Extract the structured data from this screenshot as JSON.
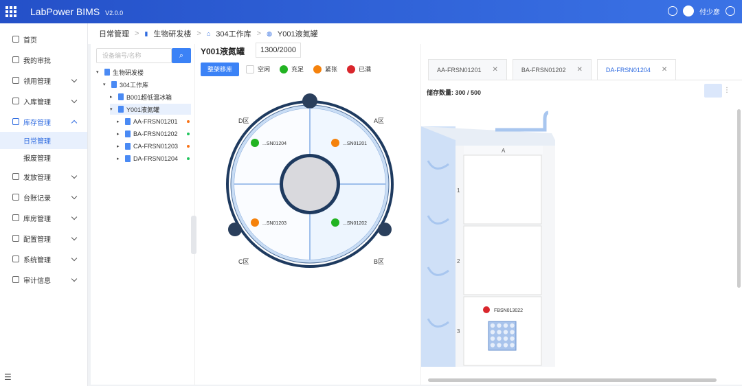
{
  "header": {
    "logo": "LabPower BIMS",
    "version": "V2.0.0",
    "user": "付少彦"
  },
  "sidebar": {
    "items": [
      {
        "label": "首页",
        "icon": "home-icon"
      },
      {
        "label": "我的审批",
        "icon": "approval-icon"
      },
      {
        "label": "领用管理",
        "icon": "claim-icon",
        "expandable": true
      },
      {
        "label": "入库管理",
        "icon": "inbound-icon",
        "expandable": true
      },
      {
        "label": "库存管理",
        "icon": "inventory-icon",
        "expandable": true,
        "active": true,
        "children": [
          {
            "label": "日常管理",
            "active": true
          },
          {
            "label": "报废管理"
          }
        ]
      },
      {
        "label": "发放管理",
        "icon": "dispatch-icon",
        "expandable": true
      },
      {
        "label": "台账记录",
        "icon": "ledger-icon",
        "expandable": true
      },
      {
        "label": "库房管理",
        "icon": "warehouse-icon",
        "expandable": true
      },
      {
        "label": "配置管理",
        "icon": "config-icon",
        "expandable": true
      },
      {
        "label": "系统管理",
        "icon": "system-icon",
        "expandable": true
      },
      {
        "label": "审计信息",
        "icon": "audit-icon",
        "expandable": true
      }
    ]
  },
  "breadcrumb": [
    "日常管理",
    "生物研发楼",
    "304工作库",
    "Y001液氮罐"
  ],
  "tree": {
    "search_placeholder": "设备编号/名称",
    "nodes": [
      {
        "label": "生物研发楼",
        "level": 0
      },
      {
        "label": "304工作库",
        "level": 1
      },
      {
        "label": "B001超低温冰箱",
        "level": 2
      },
      {
        "label": "Y001液氮罐",
        "level": 2,
        "selected": true
      },
      {
        "label": "AA-FRSN01201",
        "level": 3,
        "status": "#f97316"
      },
      {
        "label": "BA-FRSN01202",
        "level": 3,
        "status": "#22c55e"
      },
      {
        "label": "CA-FRSN01203",
        "level": 3,
        "status": "#f97316"
      },
      {
        "label": "DA-FRSN01204",
        "level": 3,
        "status": "#22c55e"
      }
    ]
  },
  "panel": {
    "title": "Y001液氮罐",
    "count": "1300/2000",
    "button": "整架移库",
    "legend": [
      {
        "label": "空闲",
        "color": "#ffffff"
      },
      {
        "label": "充足",
        "color": "#22b322"
      },
      {
        "label": "紧张",
        "color": "#f5820c"
      },
      {
        "label": "已满",
        "color": "#d9262c"
      }
    ],
    "zones": [
      {
        "zone": "D区",
        "label": "...SN01204",
        "color": "#22b322"
      },
      {
        "zone": "A区",
        "label": "...SN01201",
        "color": "#f5820c"
      },
      {
        "zone": "C区",
        "label": "...SN01203",
        "color": "#f5820c"
      },
      {
        "zone": "B区",
        "label": "...SN01202",
        "color": "#22b322"
      }
    ]
  },
  "tabs": [
    {
      "label": "AA-FRSN01201",
      "active": false
    },
    {
      "label": "BA-FRSN01202",
      "active": false
    },
    {
      "label": "DA-FRSN01204",
      "active": true
    }
  ],
  "storage": {
    "label": "储存数量: 300 / 500"
  },
  "rack": {
    "column": "A",
    "rows": [
      {
        "num": "1",
        "box": null
      },
      {
        "num": "2",
        "box": null
      },
      {
        "num": "3",
        "box": {
          "label": "FBSN013022",
          "color": "#d9262c"
        }
      }
    ]
  }
}
